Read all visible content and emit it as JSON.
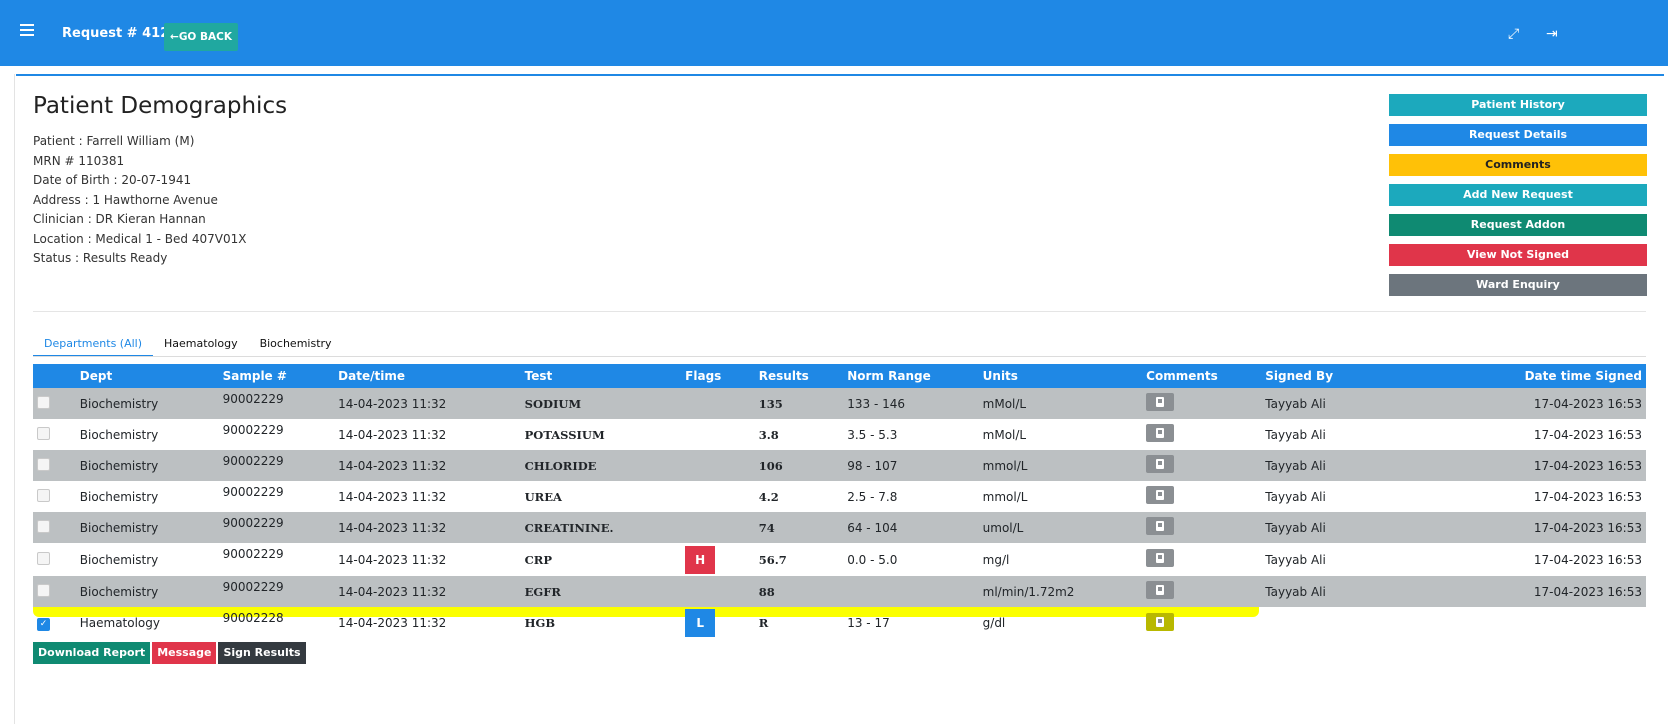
{
  "header": {
    "request_title": "Request # 41241",
    "go_back": "GO BACK",
    "expand_glyph": "⤢",
    "logout_glyph": "⇥"
  },
  "patient": {
    "title": "Patient Demographics",
    "lines": [
      "Patient : Farrell William (M)",
      "MRN # 110381",
      "Date of Birth : 20-07-1941",
      "Address : 1 Hawthorne Avenue",
      "Clinician : DR Kieran Hannan",
      "Location : Medical 1 - Bed 407V01X",
      "Status : Results Ready"
    ]
  },
  "actions": [
    {
      "label": "Patient History",
      "color": "#1ca9bd"
    },
    {
      "label": "Request Details",
      "color": "#1f88e5"
    },
    {
      "label": "Comments",
      "color": "#ffc107",
      "text_color": "#222222"
    },
    {
      "label": "Add New Request",
      "color": "#1ca9bd"
    },
    {
      "label": "Request Addon",
      "color": "#0f8a72"
    },
    {
      "label": "View Not Signed",
      "color": "#e0354a"
    },
    {
      "label": "Ward Enquiry",
      "color": "#6c757d"
    }
  ],
  "tabs": [
    "Departments (All)",
    "Haematology",
    "Biochemistry"
  ],
  "table": {
    "columns": [
      "",
      "Dept",
      "Sample #",
      "Date/time",
      "Test",
      "Flags",
      "Results",
      "Norm Range",
      "Units",
      "Comments",
      "Signed By",
      "Date time Signed"
    ],
    "rows": [
      {
        "dept": "Biochemistry",
        "sample": "90002229",
        "datetime": "14-04-2023 11:32",
        "test": "SODIUM",
        "flag": "",
        "result": "135",
        "range": "133 - 146",
        "units": "mMol/L",
        "signed_by": "Tayyab Ali",
        "signed_at": "17-04-2023 16:53"
      },
      {
        "dept": "Biochemistry",
        "sample": "90002229",
        "datetime": "14-04-2023 11:32",
        "test": "POTASSIUM",
        "flag": "",
        "result": "3.8",
        "range": "3.5 - 5.3",
        "units": "mMol/L",
        "signed_by": "Tayyab Ali",
        "signed_at": "17-04-2023 16:53"
      },
      {
        "dept": "Biochemistry",
        "sample": "90002229",
        "datetime": "14-04-2023 11:32",
        "test": "CHLORIDE",
        "flag": "",
        "result": "106",
        "range": "98 - 107",
        "units": "mmol/L",
        "signed_by": "Tayyab Ali",
        "signed_at": "17-04-2023 16:53"
      },
      {
        "dept": "Biochemistry",
        "sample": "90002229",
        "datetime": "14-04-2023 11:32",
        "test": "UREA",
        "flag": "",
        "result": "4.2",
        "range": "2.5 - 7.8",
        "units": "mmol/L",
        "signed_by": "Tayyab Ali",
        "signed_at": "17-04-2023 16:53"
      },
      {
        "dept": "Biochemistry",
        "sample": "90002229",
        "datetime": "14-04-2023 11:32",
        "test": "CREATININE.",
        "flag": "",
        "result": "74",
        "range": "64 - 104",
        "units": "umol/L",
        "signed_by": "Tayyab Ali",
        "signed_at": "17-04-2023 16:53"
      },
      {
        "dept": "Biochemistry",
        "sample": "90002229",
        "datetime": "14-04-2023 11:32",
        "test": "CRP",
        "flag": "H",
        "result": "56.7",
        "range": "0.0 - 5.0",
        "units": "mg/l",
        "signed_by": "Tayyab Ali",
        "signed_at": "17-04-2023 16:53"
      },
      {
        "dept": "Biochemistry",
        "sample": "90002229",
        "datetime": "14-04-2023 11:32",
        "test": "EGFR",
        "flag": "",
        "result": "88",
        "range": "",
        "units": "ml/min/1.72m2",
        "signed_by": "Tayyab Ali",
        "signed_at": "17-04-2023 16:53"
      },
      {
        "dept": "Haematology",
        "sample": "90002228",
        "datetime": "14-04-2023 11:32",
        "test": "HGB",
        "flag": "L",
        "result": "R",
        "range": "13 - 17",
        "units": "g/dl",
        "signed_by": "",
        "signed_at": ""
      }
    ]
  },
  "bottom_buttons": [
    {
      "label": "Download Report",
      "color": "#0f8a72"
    },
    {
      "label": "Message",
      "color": "#e0354a"
    },
    {
      "label": "Sign Results",
      "color": "#343a40"
    }
  ]
}
